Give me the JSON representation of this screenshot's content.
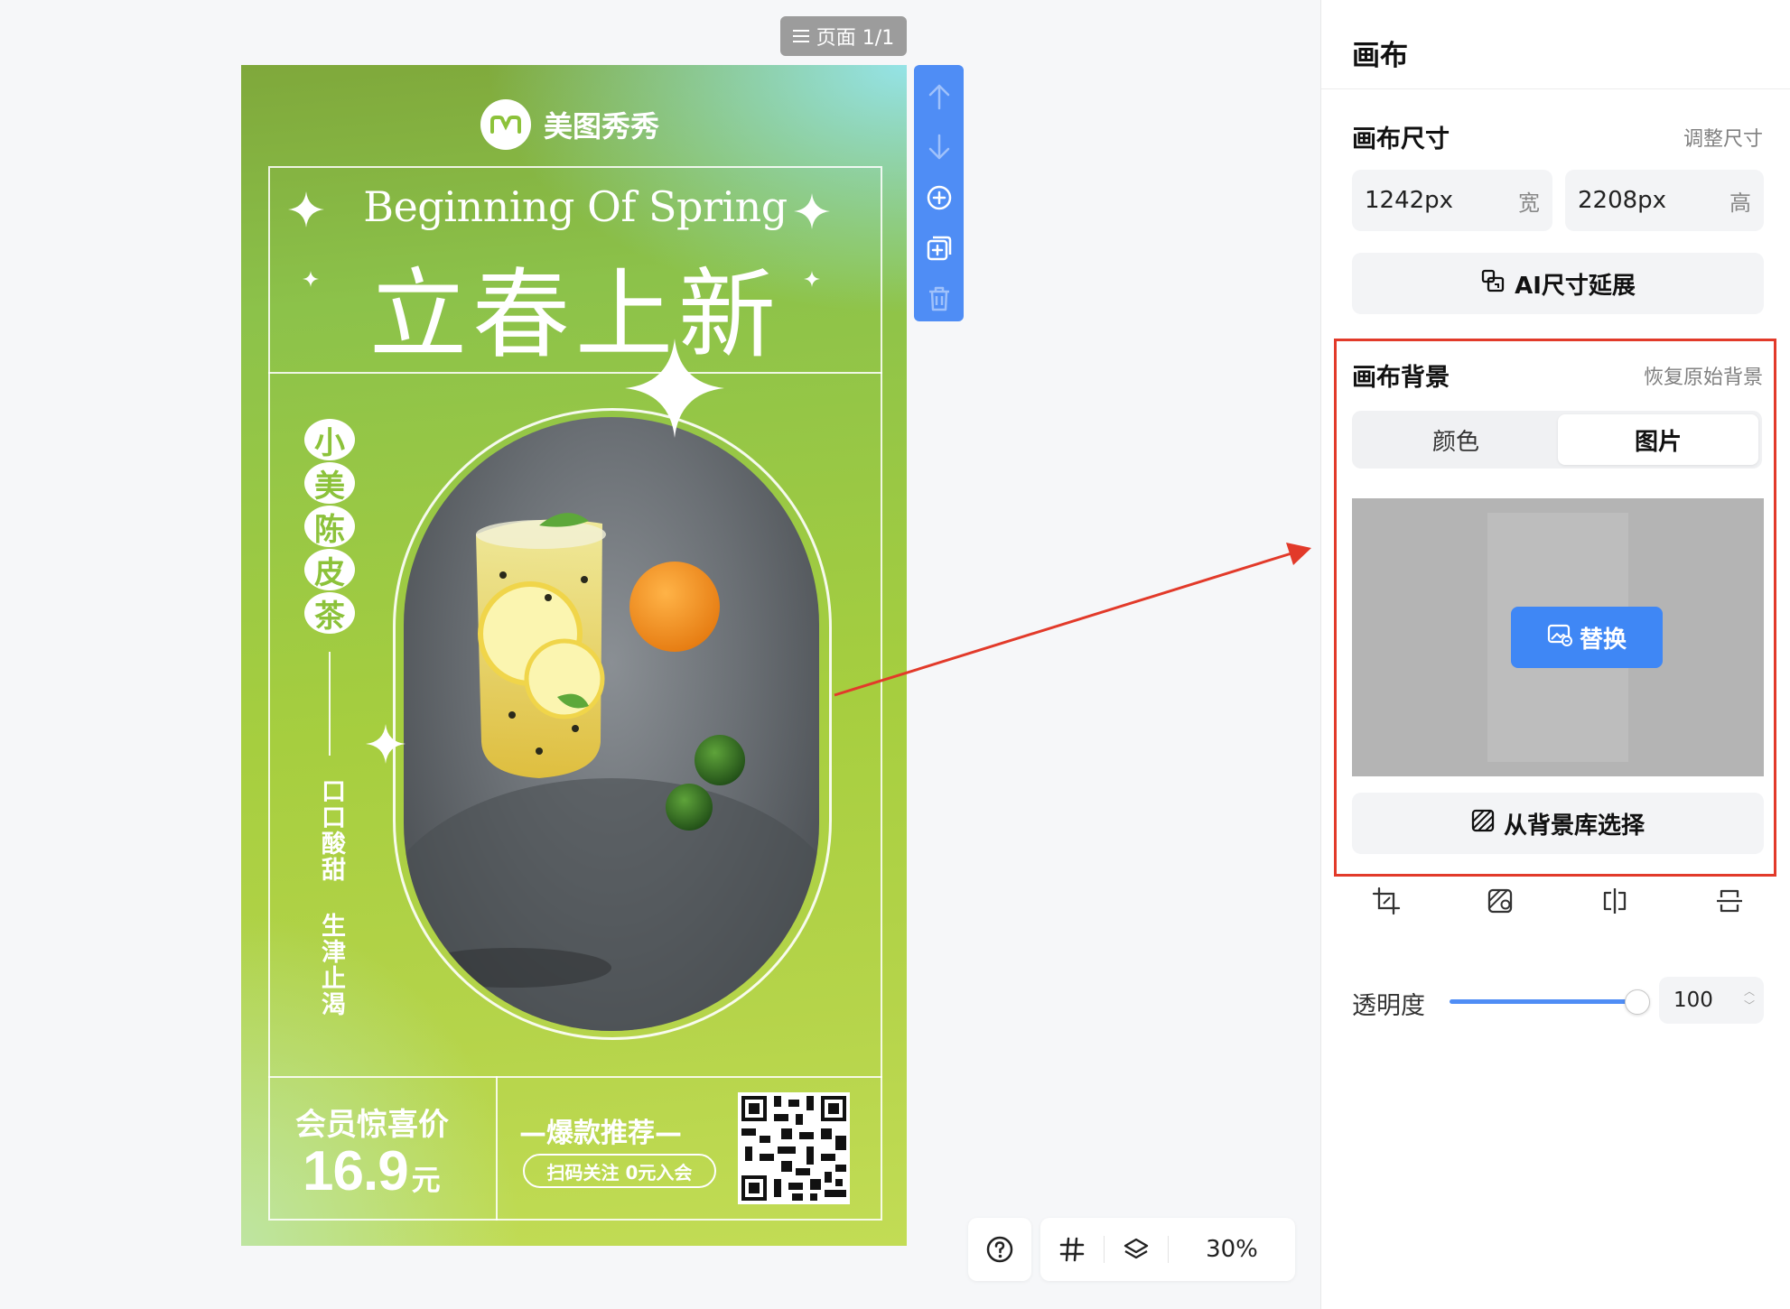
{
  "canvas": {
    "page_indicator": "页面 1/1",
    "zoom": "30%",
    "poster": {
      "brand": "美图秀秀",
      "title_en": "Beginning Of Spring",
      "title_cn": "立春上新",
      "product_chars": [
        "小",
        "美",
        "陈",
        "皮",
        "茶"
      ],
      "slogan": "口口酸甜 生津止渴",
      "price_label": "会员惊喜价",
      "price": "16.9",
      "price_unit": "元",
      "promo_title": "—爆款推荐—",
      "promo_pill": "扫码关注 0元入会"
    },
    "side_toolbar": [
      "arrow-up-icon",
      "arrow-down-icon",
      "add-page-icon",
      "duplicate-page-icon",
      "trash-icon"
    ],
    "bottom_tools": [
      "help-icon",
      "grid-icon",
      "layers-icon"
    ]
  },
  "panel": {
    "title": "画布",
    "size_section": {
      "title": "画布尺寸",
      "adjust_link": "调整尺寸",
      "width_value": "1242px",
      "width_unit": "宽",
      "height_value": "2208px",
      "height_unit": "高",
      "ai_extend_label": "AI尺寸延展"
    },
    "bg_section": {
      "title": "画布背景",
      "restore_link": "恢复原始背景",
      "tabs": [
        "颜色",
        "图片"
      ],
      "active_tab": "图片",
      "replace_label": "替换",
      "library_label": "从背景库选择"
    },
    "image_tools": [
      "crop-icon",
      "image-edit-icon",
      "flip-horizontal-icon",
      "flip-vertical-icon"
    ],
    "opacity": {
      "label": "透明度",
      "value": "100",
      "level": 1.0
    }
  },
  "colors": {
    "accent": "#4f8df5",
    "annotation": "#e23a2a",
    "poster_green": "#a6ce3f"
  }
}
